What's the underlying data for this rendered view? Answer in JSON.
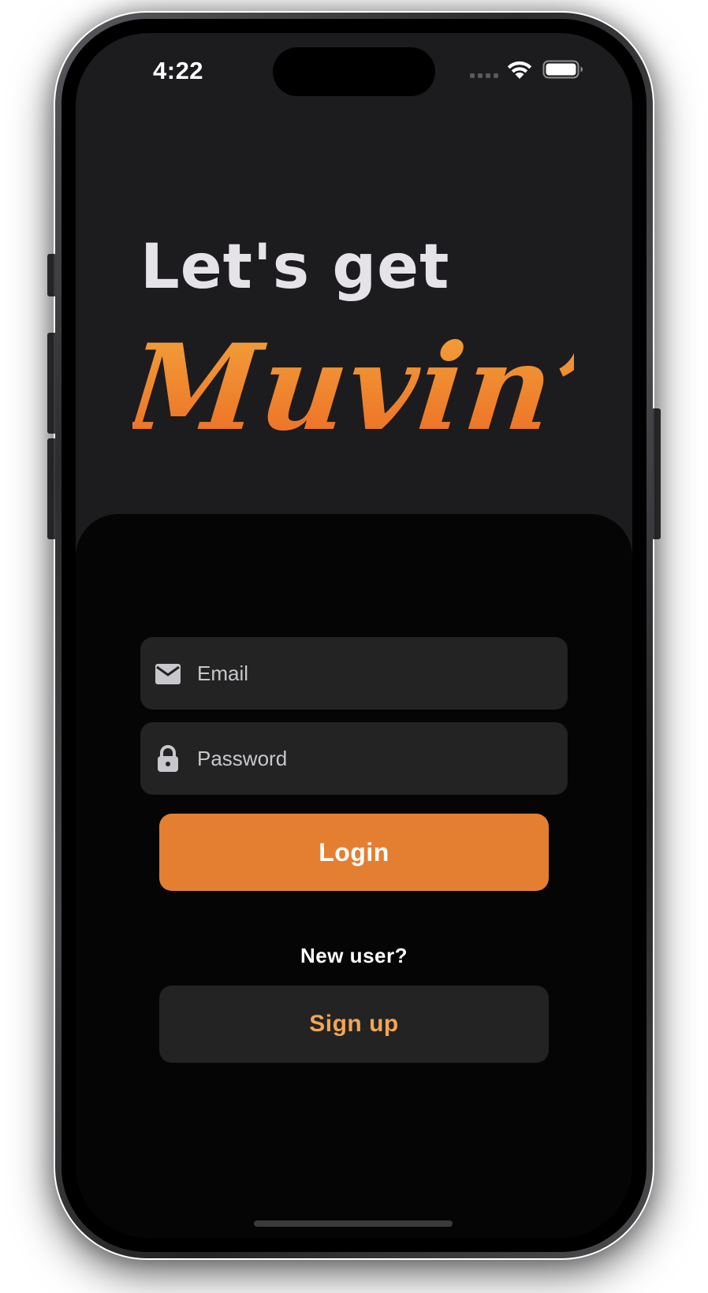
{
  "status_bar": {
    "time": "4:22",
    "icons": [
      "cellular-signal-icon",
      "wifi-icon",
      "battery-icon"
    ]
  },
  "hero": {
    "headline": "Let's get",
    "logo_text": "Muvin’"
  },
  "form": {
    "email": {
      "placeholder": "Email",
      "value": "",
      "icon": "envelope-icon"
    },
    "password": {
      "placeholder": "Password",
      "value": "",
      "icon": "lock-icon"
    },
    "login_label": "Login",
    "new_user_label": "New user?",
    "signup_label": "Sign up"
  },
  "colors": {
    "background": "#1c1c1e",
    "sheet": "#050505",
    "field": "#232323",
    "accent": "#e47f32",
    "accent_text": "#f3a552",
    "logo_gradient_top": "#f2a43a",
    "logo_gradient_bottom": "#ec6a24"
  }
}
